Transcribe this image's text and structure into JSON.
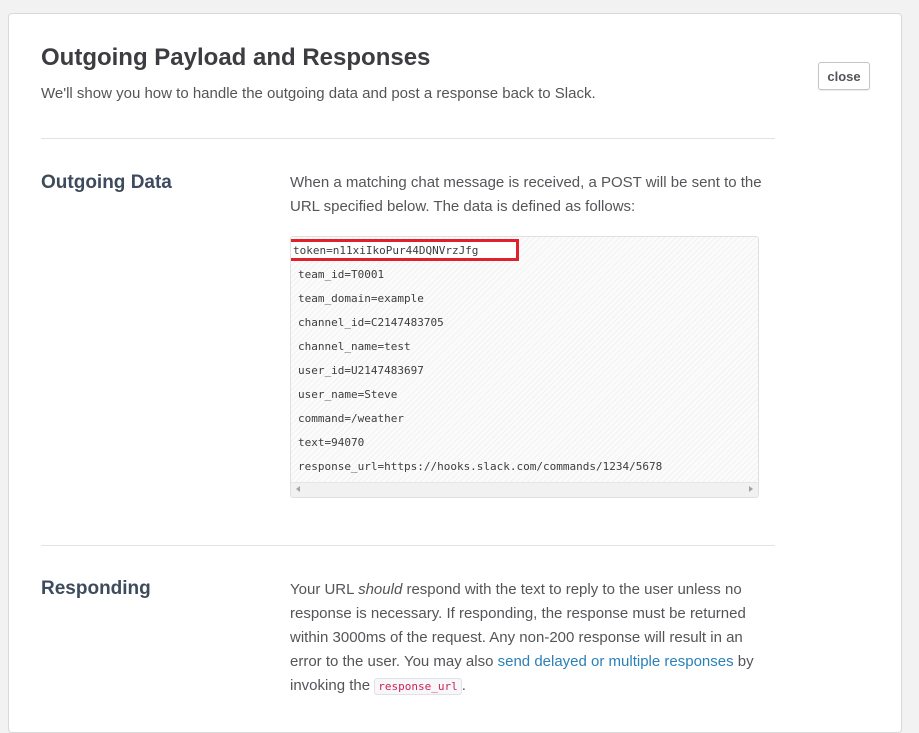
{
  "modal": {
    "title": "Outgoing Payload and Responses",
    "subtitle": "We'll show you how to handle the outgoing data and post a response back to Slack.",
    "close_label": "close"
  },
  "outgoing_data": {
    "heading": "Outgoing Data",
    "description": "When a matching chat message is received, a POST will be sent to the URL specified below. The data is defined as follows:",
    "highlighted_token": "token=n11xiIkoPur44DQNVrzJfg",
    "lines": [
      "",
      "team_id=T0001",
      "team_domain=example",
      "channel_id=C2147483705",
      "channel_name=test",
      "user_id=U2147483697",
      "user_name=Steve",
      "command=/weather",
      "text=94070",
      "response_url=https://hooks.slack.com/commands/1234/5678"
    ]
  },
  "responding": {
    "heading": "Responding",
    "text_part1": "Your URL ",
    "text_em": "should",
    "text_part2": " respond with the text to reply to the user unless no response is necessary. If responding, the response must be returned within 3000ms of the request. Any non-200 response will result in an error to the user. You may also ",
    "link_text": "send delayed or multiple responses",
    "text_part3": " by invoking the ",
    "inline_code": "response_url",
    "text_part4": "."
  },
  "colors": {
    "highlight": "#e0212b",
    "link": "#2a80b9",
    "heading": "#3d4b5c"
  }
}
